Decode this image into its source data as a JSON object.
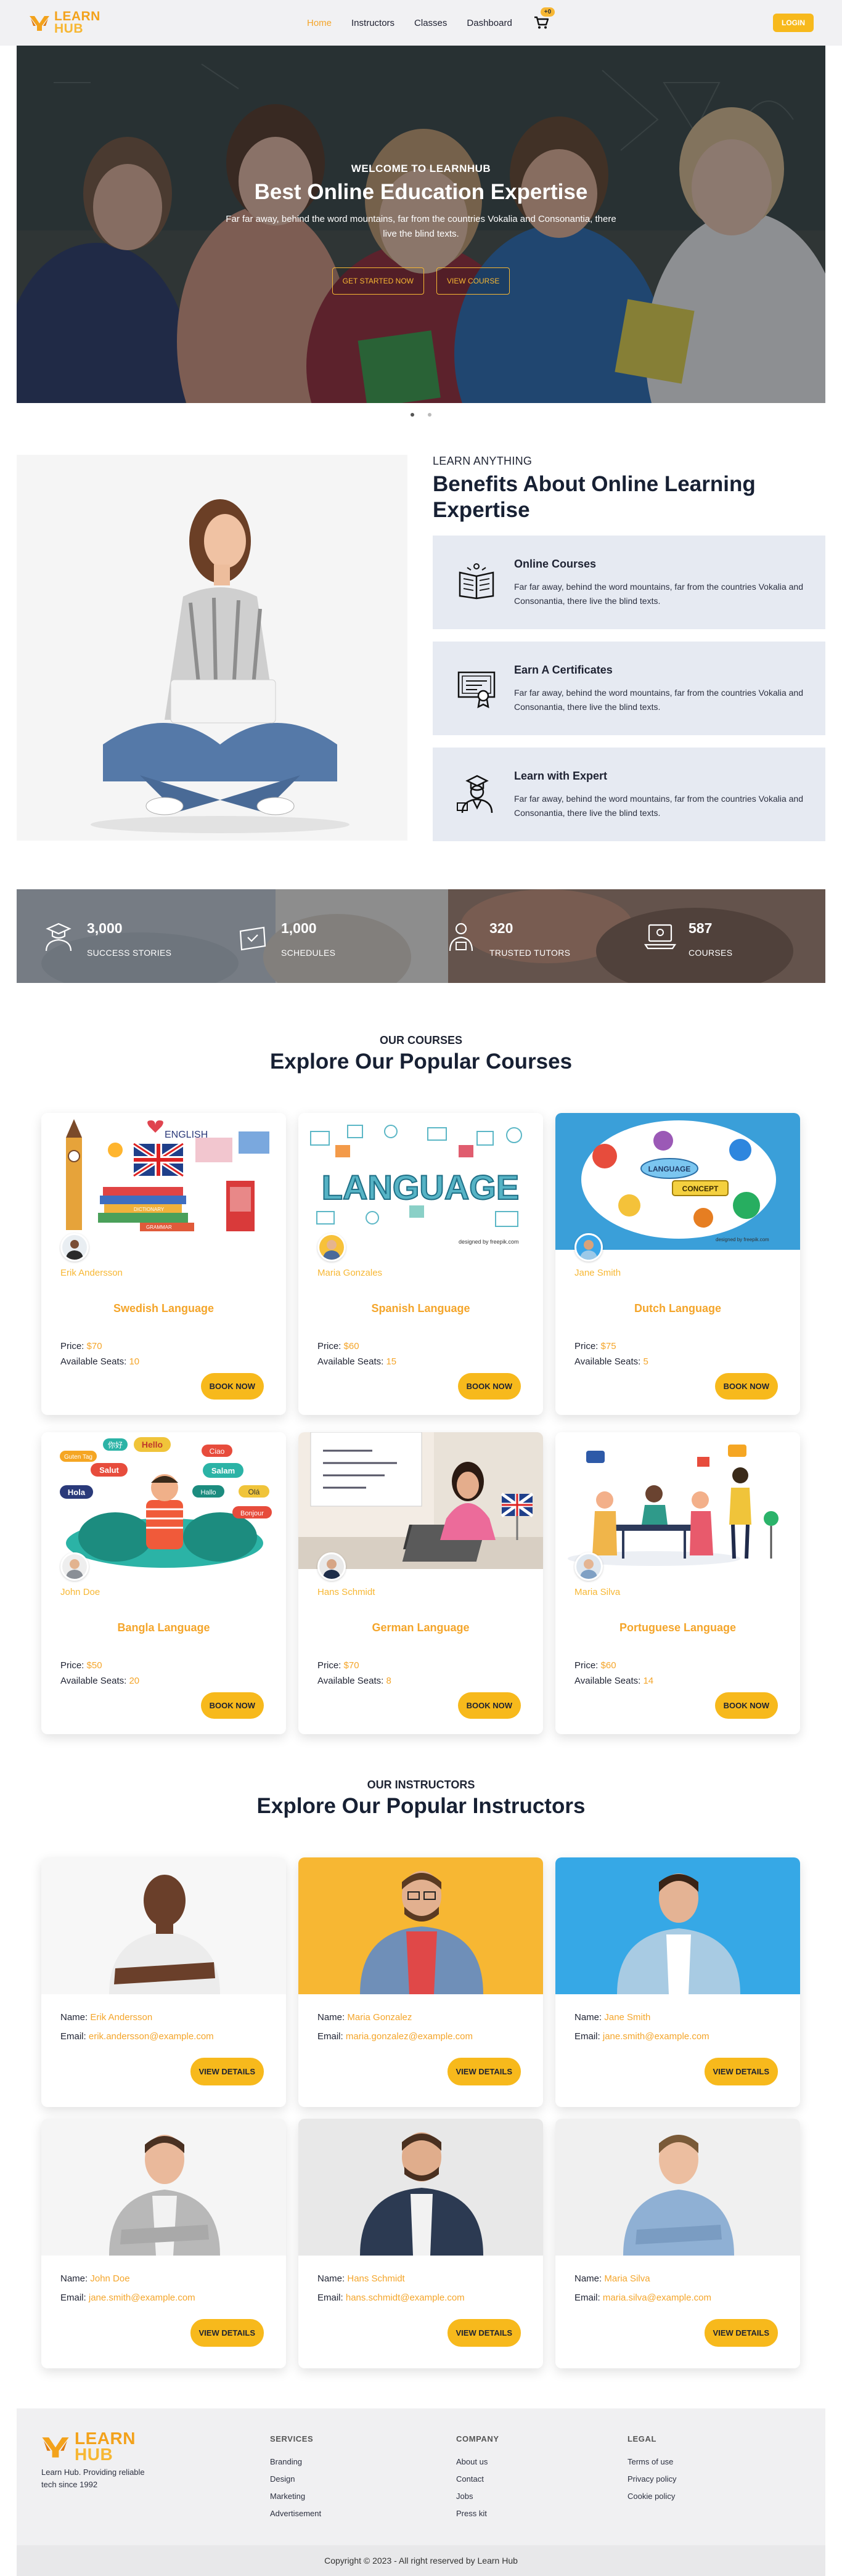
{
  "nav": {
    "brand_top": "LEARN",
    "brand_bottom": "HUB",
    "links": [
      {
        "label": "Home",
        "active": true
      },
      {
        "label": "Instructors",
        "active": false
      },
      {
        "label": "Classes",
        "active": false
      },
      {
        "label": "Dashboard",
        "active": false
      }
    ],
    "cart_badge": "+0",
    "cart_icon": "cart-icon",
    "login_label": "LOGIN"
  },
  "hero": {
    "eyebrow": "WELCOME TO LEARNHUB",
    "title": "Best Online Education Expertise",
    "subtitle": "Far far away, behind the word mountains, far from the countries Vokalia and Consonantia, there live the blind texts.",
    "primary_btn": "GET STARTED NOW",
    "secondary_btn": "VIEW COURSE"
  },
  "benefits": {
    "eyebrow": "LEARN ANYTHING",
    "title": "Benefits About Online Learning Expertise",
    "items": [
      {
        "title": "Online Courses",
        "text": "Far far away, behind the word mountains, far from the countries Vokalia and Consonantia, there live the blind texts.",
        "icon": "open-book-icon"
      },
      {
        "title": "Earn A Certificates",
        "text": "Far far away, behind the word mountains, far from the countries Vokalia and Consonantia, there live the blind texts.",
        "icon": "certificate-icon"
      },
      {
        "title": "Learn with Expert",
        "text": "Far far away, behind the word mountains, far from the countries Vokalia and Consonantia, there live the blind texts.",
        "icon": "expert-icon"
      }
    ]
  },
  "stats": [
    {
      "value": "3,000",
      "label": "SUCCESS STORIES",
      "icon": "graduate-icon"
    },
    {
      "value": "1,000",
      "label": "SCHEDULES",
      "icon": "calendar-icon"
    },
    {
      "value": "320",
      "label": "TRUSTED TUTORS",
      "icon": "tutor-icon"
    },
    {
      "value": "587",
      "label": "COURSES",
      "icon": "laptop-icon"
    }
  ],
  "courses": {
    "eyebrow": "OUR COURSES",
    "title": "Explore Our Popular Courses",
    "price_label": "Price:",
    "seats_label": "Available Seats:",
    "book_label": "BOOK NOW",
    "items": [
      {
        "instructor": "Erik Andersson",
        "title": "Swedish Language",
        "price": "$70",
        "seats": "10"
      },
      {
        "instructor": "Maria Gonzales",
        "title": "Spanish Language",
        "price": "$60",
        "seats": "15"
      },
      {
        "instructor": "Jane Smith",
        "title": "Dutch Language",
        "price": "$75",
        "seats": "5"
      },
      {
        "instructor": "John Doe",
        "title": "Bangla Language",
        "price": "$50",
        "seats": "20"
      },
      {
        "instructor": "Hans Schmidt",
        "title": "German Language",
        "price": "$70",
        "seats": "8"
      },
      {
        "instructor": "Maria Silva",
        "title": "Portuguese Language",
        "price": "$60",
        "seats": "14"
      }
    ],
    "thumb_texts": {
      "english": "ENGLISH",
      "language": "LANGUAGE",
      "language_small": "LANGUAGE",
      "concept": "CONCEPT",
      "dictionary": "DICTIONARY",
      "grammar": "GRAMMAR",
      "hello": "Hello",
      "salut": "Salut",
      "hola": "Hola",
      "ciao": "Ciao",
      "salam": "Salam",
      "ola": "Olá",
      "guten_tag": "Guten Tag",
      "ni_hao": "你好",
      "hallo": "Hallo",
      "bonjour": "Bonjour",
      "credit": "designed by freepik.com",
      "credit2": "designed by freepik.com"
    }
  },
  "instructors": {
    "eyebrow": "OUR INSTRUCTORS",
    "title": "Explore Our Popular Instructors",
    "name_label": "Name:",
    "email_label": "Email:",
    "details_label": "VIEW DETAILS",
    "items": [
      {
        "name": "Erik Andersson",
        "email": "erik.andersson@example.com"
      },
      {
        "name": "Maria Gonzalez",
        "email": "maria.gonzalez@example.com"
      },
      {
        "name": "Jane Smith",
        "email": "jane.smith@example.com"
      },
      {
        "name": "John Doe",
        "email": "jane.smith@example.com"
      },
      {
        "name": "Hans Schmidt",
        "email": "hans.schmidt@example.com"
      },
      {
        "name": "Maria Silva",
        "email": "maria.silva@example.com"
      }
    ]
  },
  "footer": {
    "brand_top": "LEARN",
    "brand_bottom": "HUB",
    "tagline": "Learn Hub. Providing reliable tech since 1992",
    "columns": [
      {
        "heading": "SERVICES",
        "links": [
          "Branding",
          "Design",
          "Marketing",
          "Advertisement"
        ]
      },
      {
        "heading": "COMPANY",
        "links": [
          "About us",
          "Contact",
          "Jobs",
          "Press kit"
        ]
      },
      {
        "heading": "LEGAL",
        "links": [
          "Terms of use",
          "Privacy policy",
          "Cookie policy"
        ]
      }
    ],
    "copyright": "Copyright © 2023 - All right reserved by Learn Hub"
  },
  "colors": {
    "accent": "#f7b733",
    "accent_text": "#f4a52a",
    "benefit_card_bg": "#e6eaf2",
    "dark_text": "#172033"
  }
}
